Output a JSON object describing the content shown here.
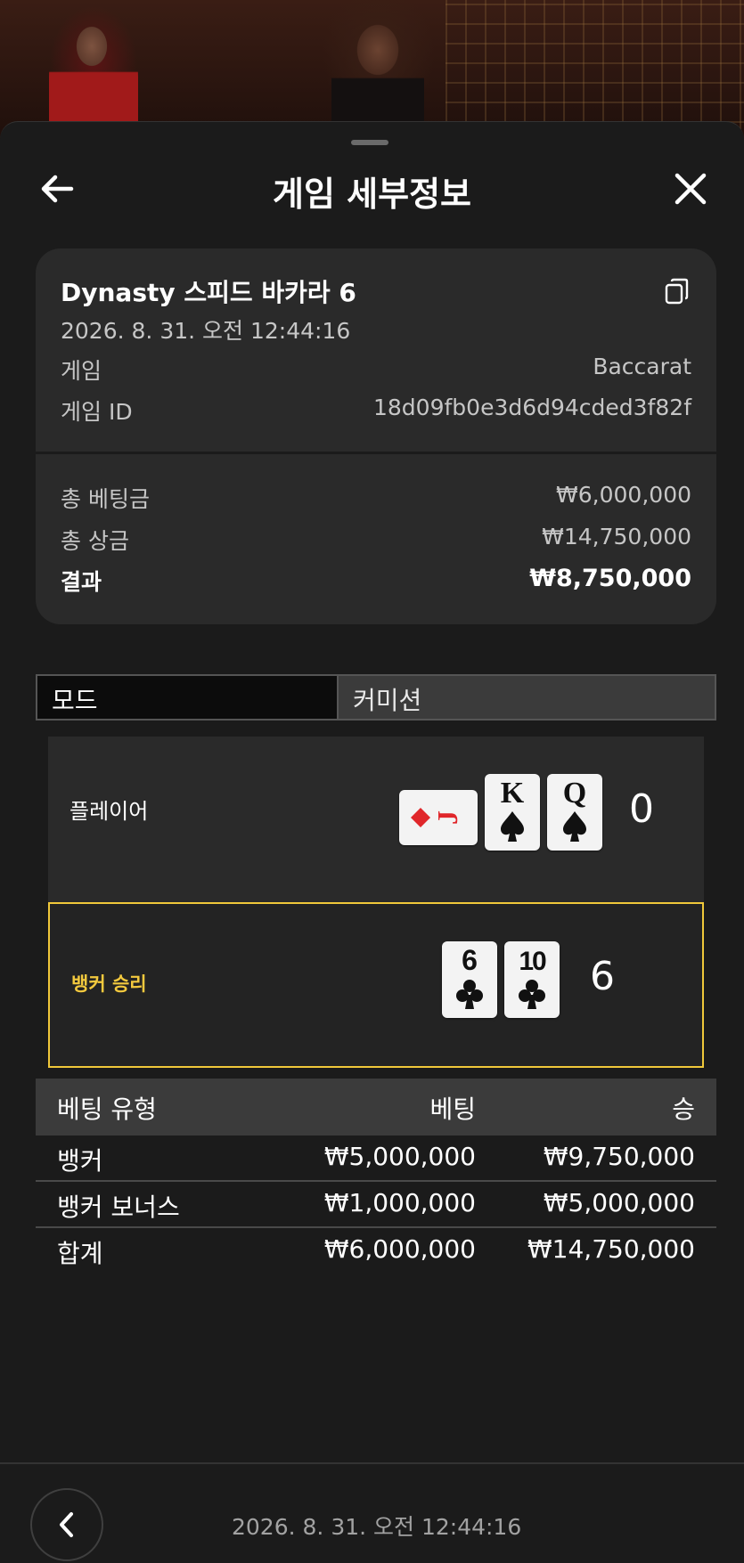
{
  "header": {
    "title": "게임 세부정보"
  },
  "summary": {
    "table_name": "Dynasty 스피드 바카라 6",
    "datetime": "2026. 8. 31. 오전 12:44:16",
    "game_label": "게임",
    "game_value": "Baccarat",
    "game_id_label": "게임 ID",
    "game_id_value": "18d09fb0e3d6d94cded3f82f",
    "total_bet_label": "총 베팅금",
    "total_bet_value": "₩6,000,000",
    "total_win_label": "총 상금",
    "total_win_value": "₩14,750,000",
    "result_label": "결과",
    "result_value": "₩8,750,000"
  },
  "tabs": {
    "mode": "모드",
    "commission": "커미션"
  },
  "hands": {
    "player": {
      "label": "플레이어",
      "score": "0",
      "cards": [
        {
          "rank": "J",
          "suit": "diamond",
          "orientation": "sideways"
        },
        {
          "rank": "K",
          "suit": "spade"
        },
        {
          "rank": "Q",
          "suit": "spade"
        }
      ]
    },
    "banker": {
      "label": "뱅커 승리",
      "score": "6",
      "cards": [
        {
          "rank": "6",
          "suit": "club"
        },
        {
          "rank": "10",
          "suit": "club"
        }
      ]
    }
  },
  "bets_table": {
    "headers": [
      "베팅 유형",
      "베팅",
      "승"
    ],
    "rows": [
      {
        "type": "뱅커",
        "bet": "₩5,000,000",
        "win": "₩9,750,000"
      },
      {
        "type": "뱅커 보너스",
        "bet": "₩1,000,000",
        "win": "₩5,000,000"
      }
    ],
    "total": {
      "type": "합계",
      "bet": "₩6,000,000",
      "win": "₩14,750,000"
    }
  },
  "footer": {
    "datetime": "2026. 8. 31. 오전 12:44:16"
  },
  "colors": {
    "accent_gold": "#f3c93e",
    "sheet_bg": "#1b1b1b",
    "card_bg": "#2a2a2a"
  }
}
